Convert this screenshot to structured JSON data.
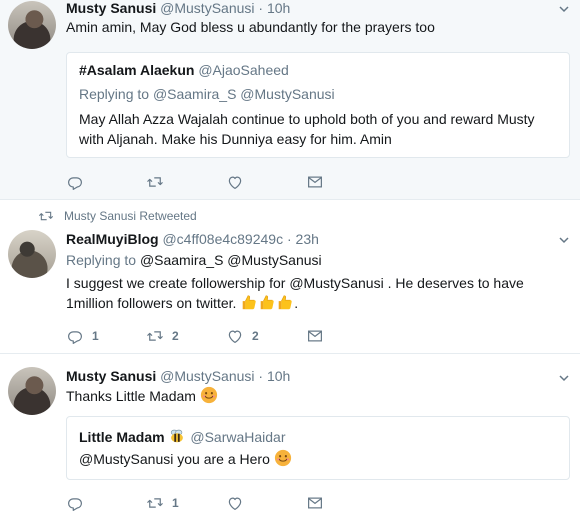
{
  "tweets": [
    {
      "author_name": "Musty Sanusi",
      "author_handle": "@MustySanusi",
      "time": "10h",
      "text": "Amin amin, May God bless u abundantly for the prayers too",
      "quote": {
        "name": "#Asalam Alaekun",
        "handle": "@AjaoSaheed",
        "replying_label": "Replying to",
        "replying_to": "@Saamira_S @MustySanusi",
        "text": "May Allah Azza Wajalah continue to uphold both of you and reward Musty with Aljanah. Make his Dunniya easy for him. Amin"
      },
      "actions": {
        "reply": "",
        "retweet": "",
        "like": ""
      }
    },
    {
      "retweet_context": "Musty Sanusi Retweeted",
      "author_name": "RealMuyiBlog",
      "author_handle": "@c4ff08e4c89249c",
      "time": "23h",
      "replying_label": "Replying to",
      "replying_to": "@Saamira_S @MustySanusi",
      "text_before": "I suggest we create followership for ",
      "text_mention": "@MustySanusi",
      "text_after": " . He deserves to have 1million followers on twitter. ",
      "text_emoji": "thumbs-up x3",
      "actions": {
        "reply": "1",
        "retweet": "2",
        "like": "2"
      }
    },
    {
      "author_name": "Musty Sanusi",
      "author_handle": "@MustySanusi",
      "time": "10h",
      "text": "Thanks Little Madam ",
      "text_emoji": "smiling-face",
      "quote": {
        "name": "Little Madam",
        "name_emoji": "bee",
        "handle": "@SarwaHaidar",
        "text": "@MustySanusi you are a Hero ",
        "text_emoji": "smiling-face"
      },
      "actions": {
        "reply": "",
        "retweet": "1",
        "like": ""
      }
    }
  ],
  "colors": {
    "text": "#14171a",
    "secondary": "#657786",
    "border": "#e6ecf0",
    "highlight_bg": "#f5f8fa",
    "link": "#1da1f2"
  },
  "separator": "·"
}
